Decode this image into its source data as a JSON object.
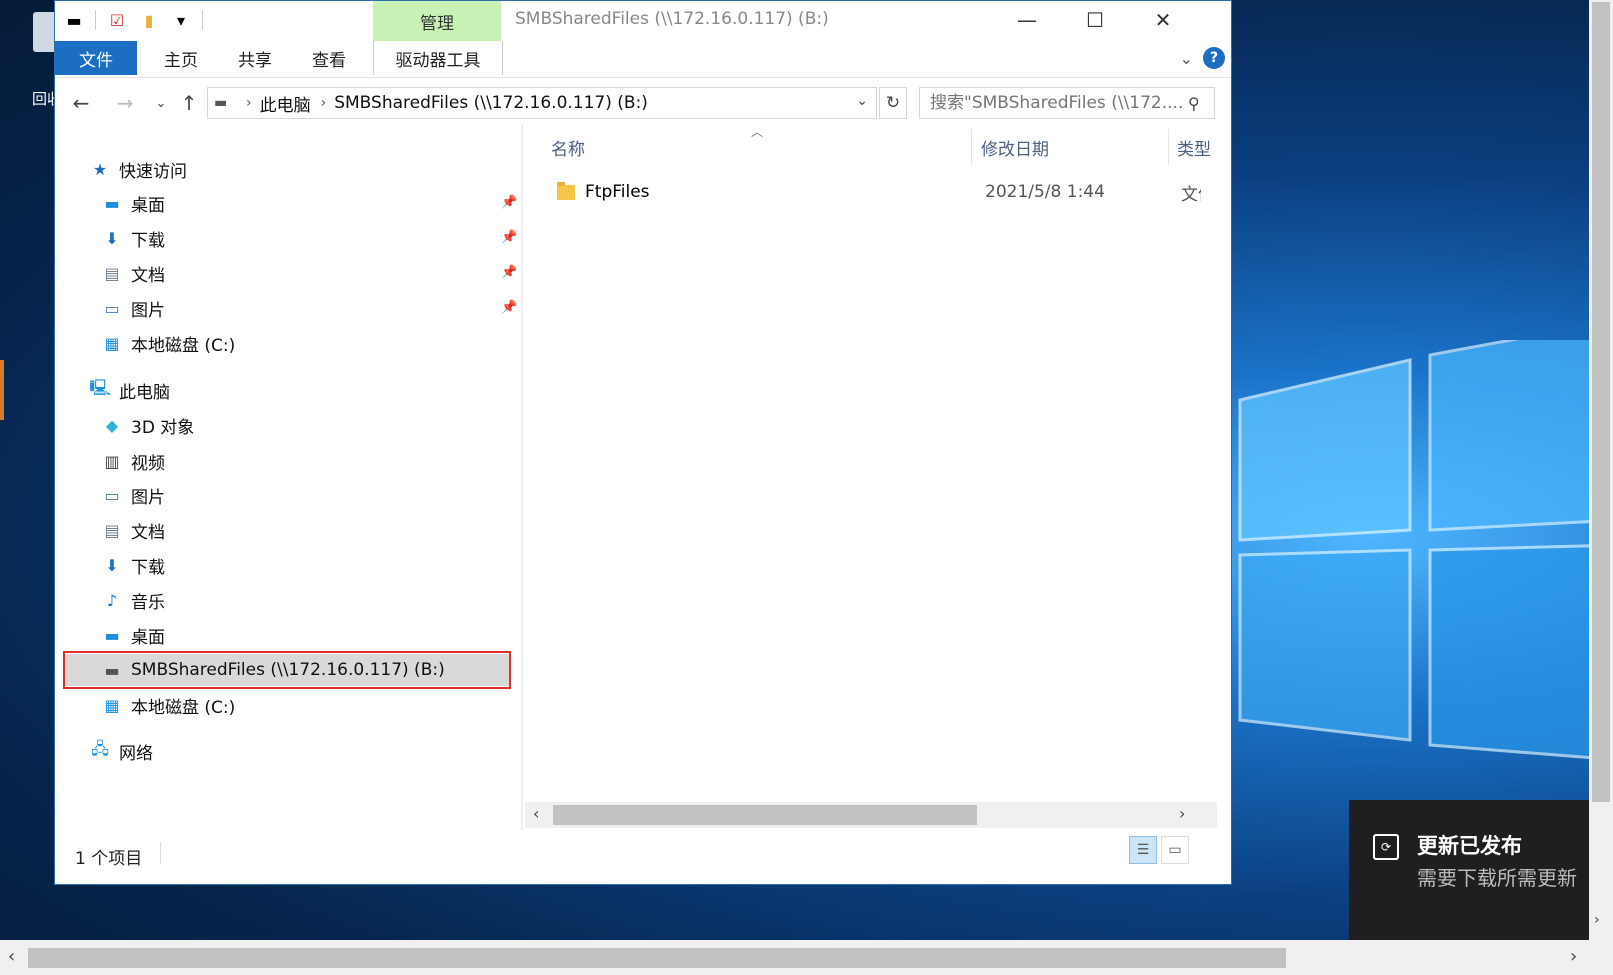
{
  "desktop": {
    "recycle_label": "回收"
  },
  "window": {
    "title": "SMBSharedFiles (\\\\172.16.0.117) (B:)",
    "context_group": "管理",
    "ribbon_tabs": [
      "文件",
      "主页",
      "共享",
      "查看",
      "驱动器工具"
    ],
    "caption": {
      "minimize": "—",
      "maximize": "☐",
      "close": "✕"
    }
  },
  "address": {
    "crumbs": [
      "此电脑",
      "SMBSharedFiles (\\\\172.16.0.117) (B:)"
    ],
    "search_placeholder": "搜索\"SMBSharedFiles (\\\\172...."
  },
  "nav": {
    "quick_access": "快速访问",
    "quick_items": [
      "桌面",
      "下载",
      "文档",
      "图片",
      "本地磁盘 (C:)"
    ],
    "this_pc": "此电脑",
    "pc_items": [
      "3D 对象",
      "视频",
      "图片",
      "文档",
      "下载",
      "音乐",
      "桌面",
      "SMBSharedFiles (\\\\172.16.0.117) (B:)",
      "本地磁盘 (C:)"
    ],
    "network": "网络"
  },
  "columns": {
    "name": "名称",
    "modified": "修改日期",
    "type": "类型"
  },
  "files": [
    {
      "name": "FtpFiles",
      "modified": "2021/5/8 1:44",
      "type": "文件夹"
    }
  ],
  "status": {
    "count": "1 个项目"
  },
  "toast": {
    "title": "更新已发布",
    "body": "需要下载所需更新"
  }
}
